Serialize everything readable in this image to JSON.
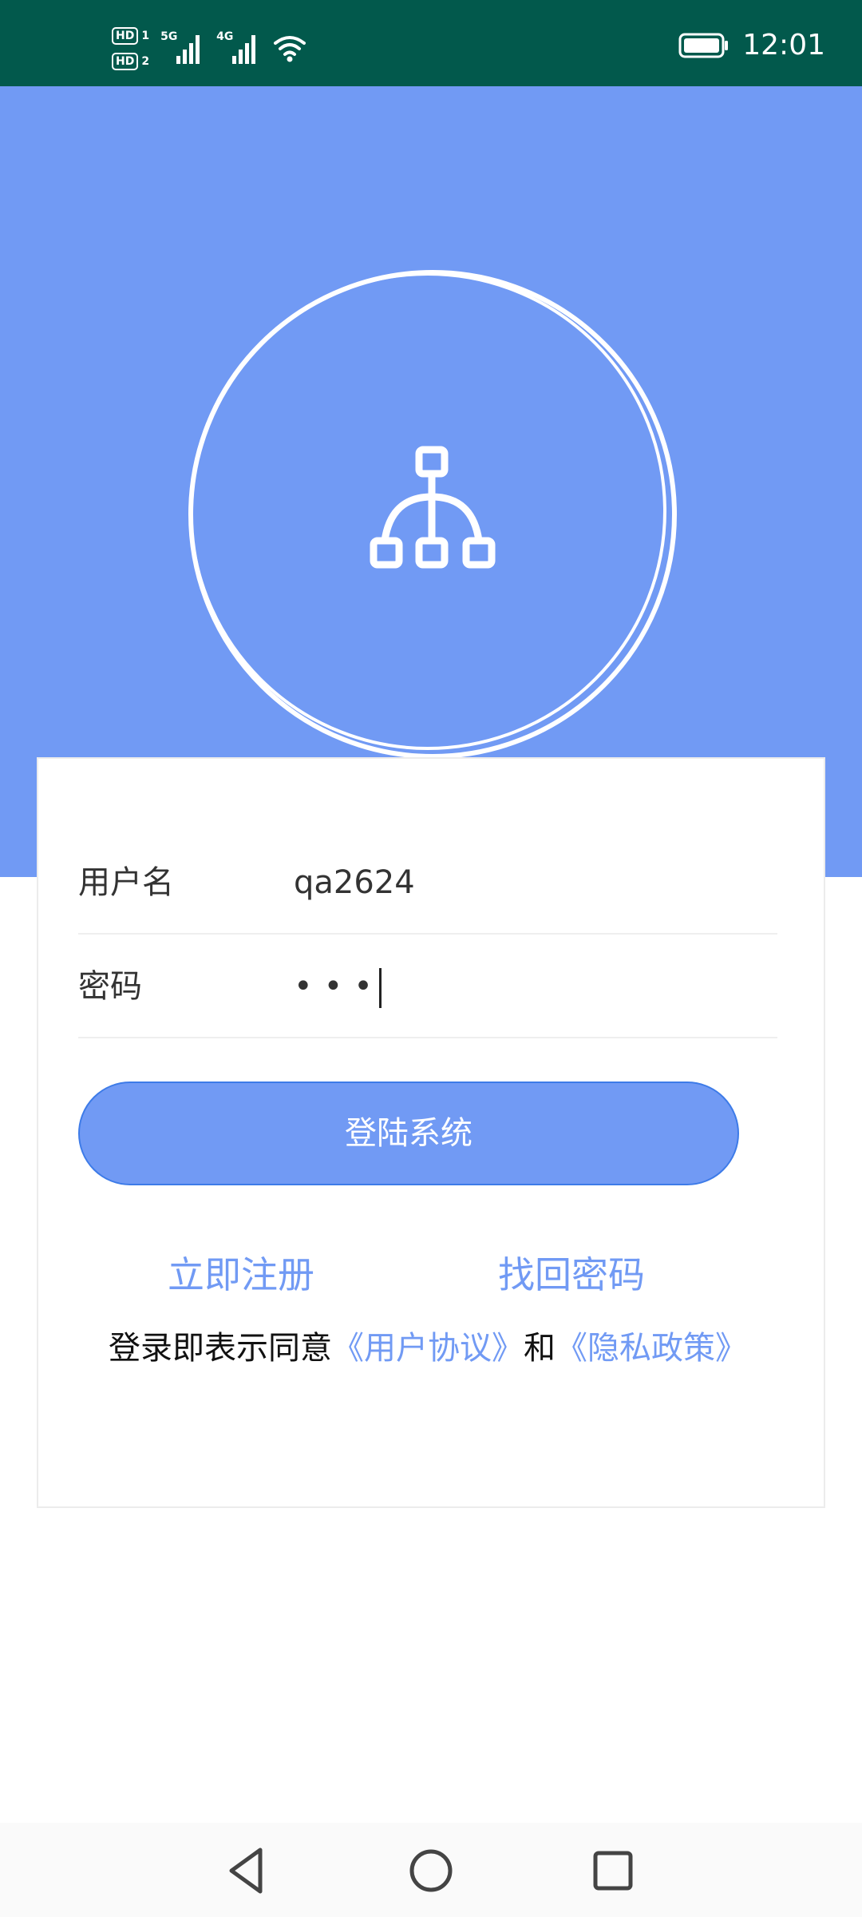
{
  "status_bar": {
    "time": "12:01",
    "sim1_label": "HD",
    "sim1_number": "1",
    "sim2_label": "HD",
    "sim2_number": "2",
    "network1": "5G",
    "network2": "4G",
    "icons": [
      "signal-icon",
      "wifi-icon",
      "battery-icon"
    ]
  },
  "colors": {
    "status_bg": "#02594C",
    "hero_bg": "#719AF4",
    "accent": "#719AF4",
    "button_border": "#3D7BE8"
  },
  "logo": {
    "icon": "hierarchy-icon"
  },
  "form": {
    "username_label": "用户名",
    "username_value": "qa2624",
    "password_label": "密码",
    "password_masked": "•••"
  },
  "login_button": {
    "label": "登陆系统"
  },
  "links": {
    "register": "立即注册",
    "forgot_password": "找回密码"
  },
  "agreement": {
    "prefix": "登录即表示同意",
    "user_agreement": "《用户协议》",
    "and": "和",
    "privacy_policy": "《隐私政策》"
  },
  "nav": {
    "icons": [
      "back-icon",
      "home-icon",
      "recents-icon"
    ]
  }
}
